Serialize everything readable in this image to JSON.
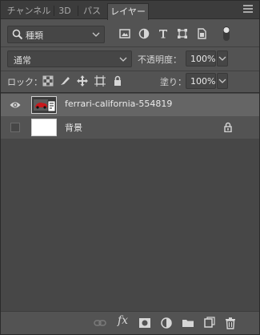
{
  "tabs": [
    {
      "label": "チャンネル",
      "active": false
    },
    {
      "label": "3D",
      "active": false
    },
    {
      "label": "パス",
      "active": false
    },
    {
      "label": "レイヤー",
      "active": true
    }
  ],
  "filter": {
    "kind_label": "種類",
    "icons": [
      "image-filter-icon",
      "adjustment-filter-icon",
      "type-filter-icon",
      "shape-filter-icon",
      "smart-object-filter-icon",
      "filter-toggle-icon"
    ]
  },
  "blend": {
    "mode": "通常",
    "opacity_label": "不透明度：",
    "opacity_value": "100%"
  },
  "lock": {
    "label": "ロック：",
    "fill_label": "塗り：",
    "fill_value": "100%"
  },
  "layers": [
    {
      "name": "ferrari-california-554819",
      "visible": true,
      "selected": true,
      "smart_object": true,
      "locked": false
    },
    {
      "name": "背景",
      "visible": false,
      "selected": false,
      "smart_object": false,
      "locked": true
    }
  ],
  "bottom_icons": [
    "link-layers-icon",
    "fx-icon",
    "add-mask-icon",
    "adjustment-layer-icon",
    "new-group-icon",
    "new-layer-icon",
    "delete-layer-icon"
  ],
  "colors": {
    "panel": "#535353",
    "tabbar": "#3c3c3c",
    "list": "#474747",
    "selected_row": "#656565"
  }
}
